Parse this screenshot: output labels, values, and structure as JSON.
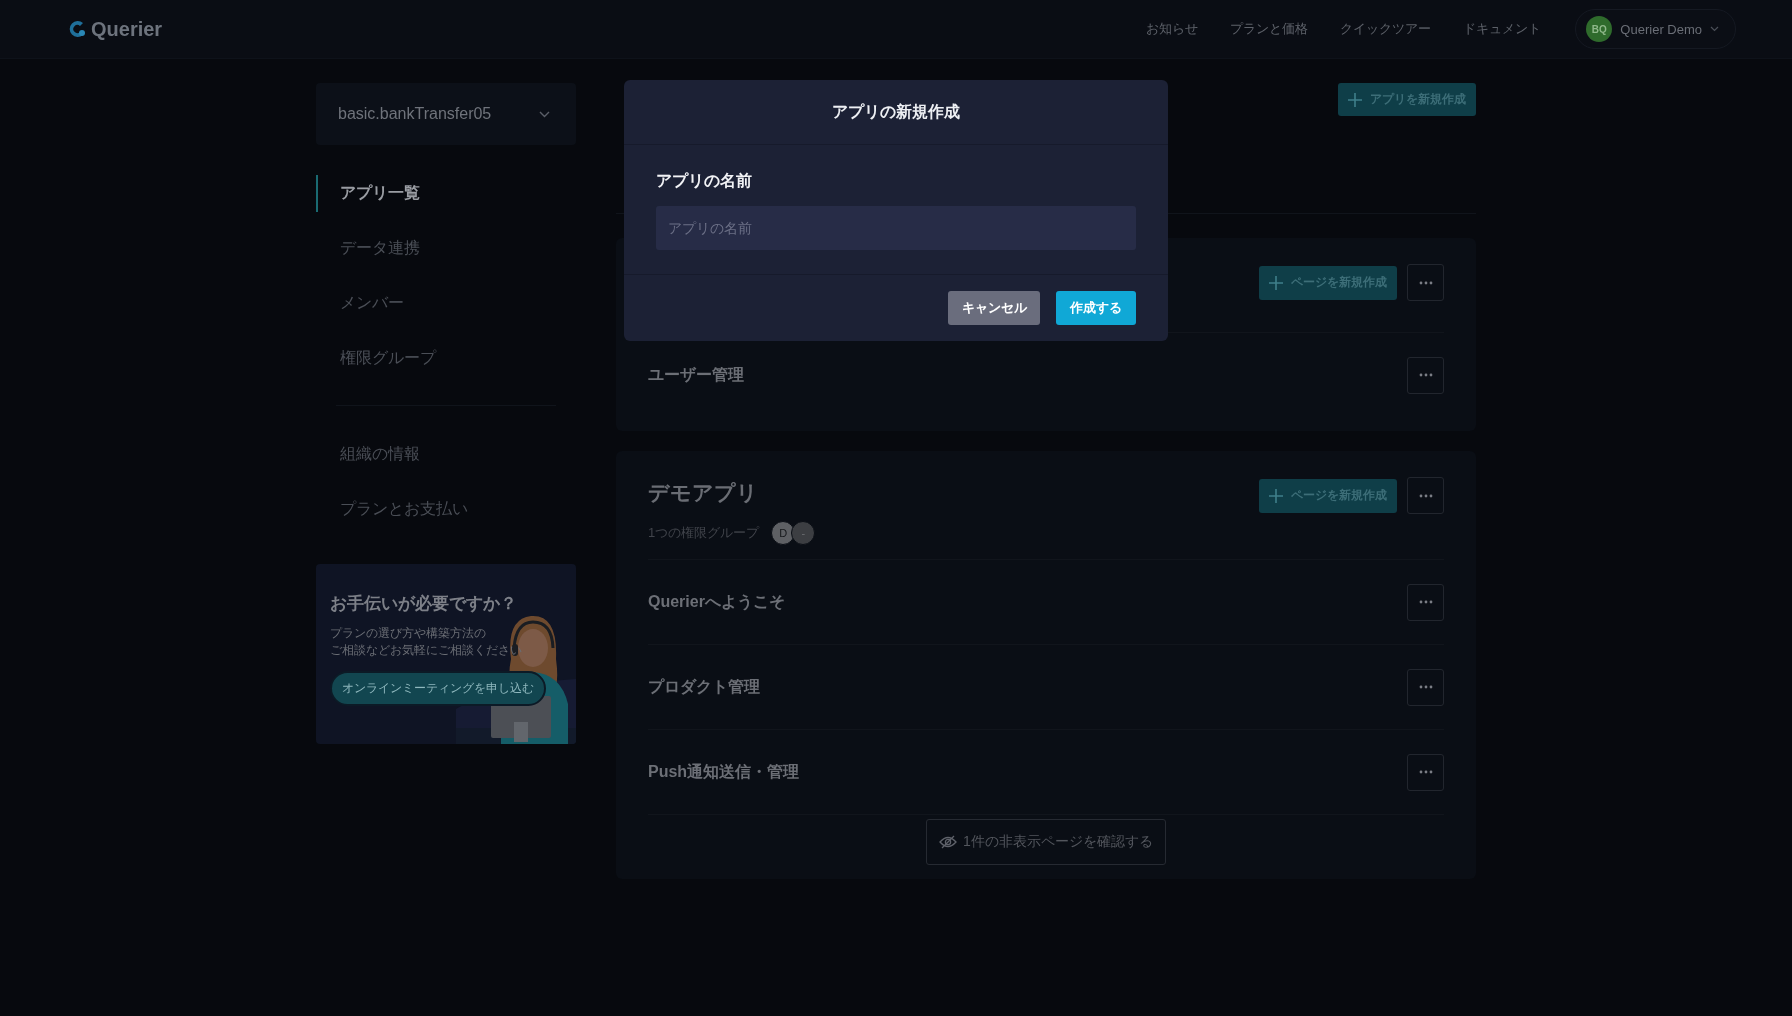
{
  "header": {
    "logo": "Querier",
    "nav": [
      "お知らせ",
      "プランと価格",
      "クイックツアー",
      "ドキュメント"
    ],
    "user": {
      "initials": "BQ",
      "name": "Querier Demo"
    }
  },
  "sidebar": {
    "org_select": "basic.bankTransfer05",
    "items": [
      {
        "label": "アプリ一覧",
        "selected": true
      },
      {
        "label": "データ連携",
        "selected": false
      },
      {
        "label": "メンバー",
        "selected": false
      },
      {
        "label": "権限グループ",
        "selected": false
      }
    ],
    "items_secondary": [
      {
        "label": "組織の情報",
        "selected": false
      },
      {
        "label": "プランとお支払い",
        "selected": false
      }
    ],
    "help_card": {
      "title": "お手伝いが必要ですか？",
      "lines": [
        "プランの選び方や構築方法の",
        "ご相談などお気軽にご相談ください"
      ],
      "button": "オンラインミーティングを申し込む"
    }
  },
  "main": {
    "new_app_button": "アプリを新規作成",
    "apps": [
      {
        "new_page_button": "ページを新規作成",
        "pages": [
          "ユーザー管理"
        ]
      },
      {
        "title": "デモアプリ",
        "groups_label": "1つの権限グループ",
        "group_avatars": [
          "D",
          "-"
        ],
        "new_page_button": "ページを新規作成",
        "pages": [
          "Querierへようこそ",
          "プロダクト管理",
          "Push通知送信・管理"
        ],
        "hidden_pages_button": "1件の非表示ページを確認する"
      }
    ]
  },
  "modal": {
    "title": "アプリの新規作成",
    "field_label": "アプリの名前",
    "placeholder": "アプリの名前",
    "buttons": [
      {
        "label": "キャンセル",
        "kind": "secondary"
      },
      {
        "label": "作成する",
        "kind": "primary"
      }
    ]
  }
}
